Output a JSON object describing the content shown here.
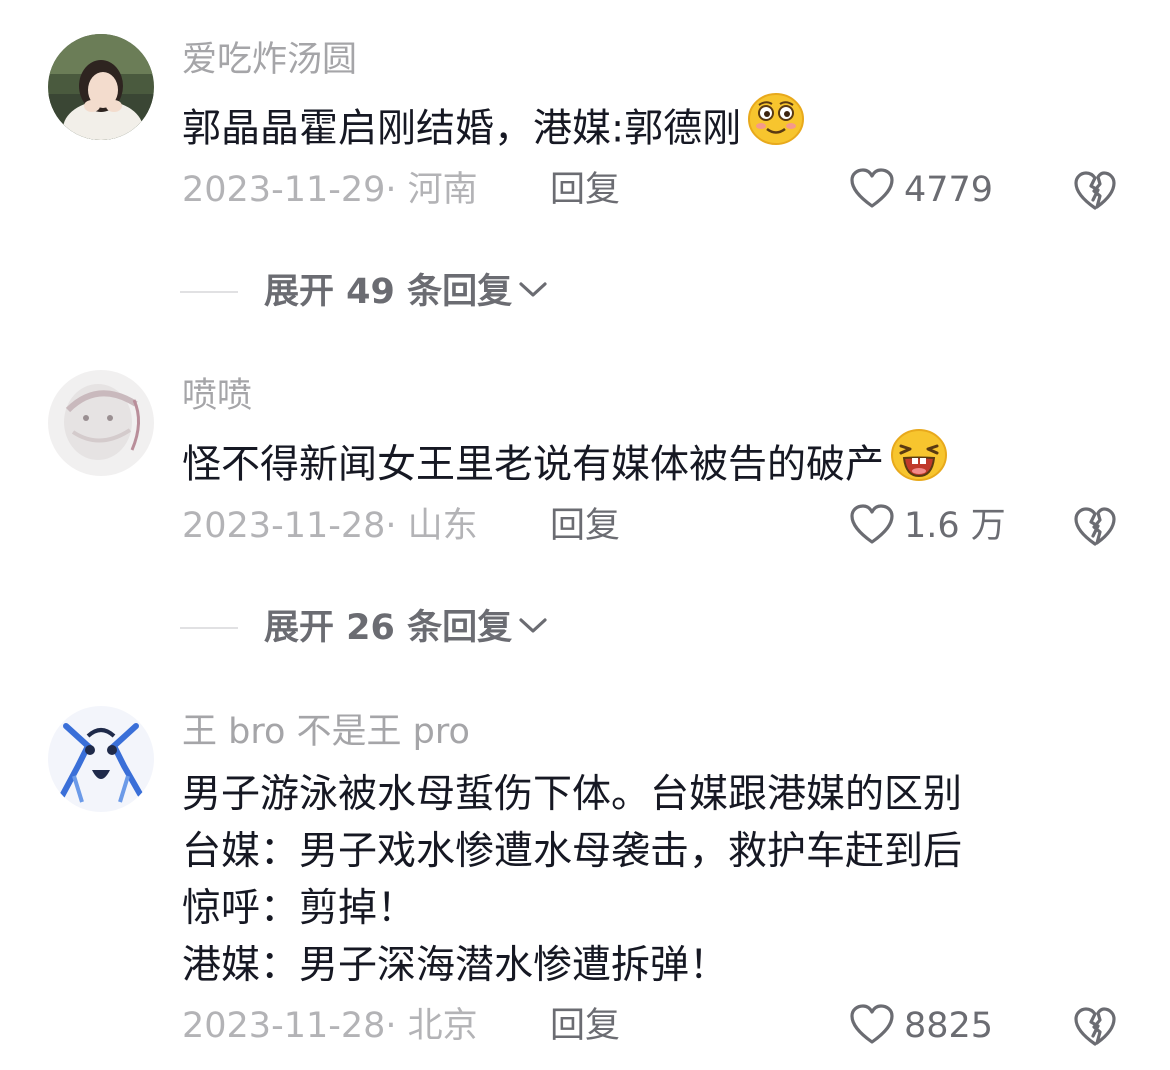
{
  "comments": [
    {
      "username": "爱吃炸汤圆",
      "text_lines": [
        "郭晶晶霍启刚结婚，港媒:郭德刚"
      ],
      "emoji": "smirk-face-emoji",
      "date_location": "2023-11-29· 河南",
      "reply_label": "回复",
      "likes": "4779",
      "expand_label": "展开 49 条回复"
    },
    {
      "username": "喷喷",
      "text_lines": [
        "怪不得新闻女王里老说有媒体被告的破产"
      ],
      "emoji": "laughing-face-emoji",
      "date_location": "2023-11-28· 山东",
      "reply_label": "回复",
      "likes": "1.6 万",
      "expand_label": "展开 26 条回复"
    },
    {
      "username": "王 bro 不是王 pro",
      "text_lines": [
        "男子游泳被水母蜇伤下体。台媒跟港媒的区别",
        "台媒：男子戏水惨遭水母袭击，救护车赶到后",
        "惊呼：剪掉！",
        "港媒：男子深海潜水惨遭拆弹！"
      ],
      "date_location": "2023-11-28· 北京",
      "reply_label": "回复",
      "likes": "8825"
    }
  ],
  "icons": {
    "like": "heart-outline-icon",
    "dislike": "broken-heart-icon",
    "expand": "chevron-down-icon"
  },
  "colors": {
    "text_primary": "#161823",
    "text_secondary": "#a5a5a8",
    "text_action": "#6b6c72",
    "emoji_yellow": "#f7c52e"
  }
}
